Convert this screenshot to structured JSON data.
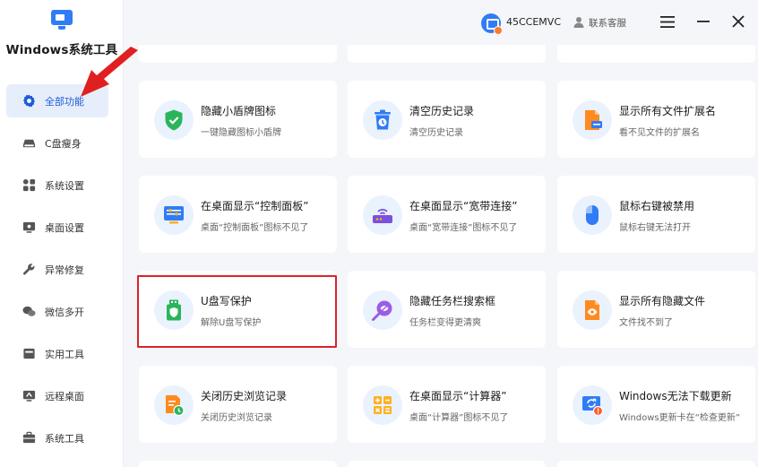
{
  "app": {
    "title": "Windows系统工具"
  },
  "sidebar": {
    "items": [
      {
        "label": "全部功能",
        "icon": "gear-icon",
        "active": true
      },
      {
        "label": "C盘瘦身",
        "icon": "drive-icon"
      },
      {
        "label": "系统设置",
        "icon": "grid-icon"
      },
      {
        "label": "桌面设置",
        "icon": "monitor-icon"
      },
      {
        "label": "异常修复",
        "icon": "wrench-icon"
      },
      {
        "label": "微信多开",
        "icon": "chat-icon"
      },
      {
        "label": "实用工具",
        "icon": "toolbox-icon"
      },
      {
        "label": "远程桌面",
        "icon": "remote-icon"
      },
      {
        "label": "系统工具",
        "icon": "briefcase-icon"
      }
    ]
  },
  "topbar": {
    "user_name": "45CCEMVC",
    "service_label": "联系客服",
    "menu_icon": "hamburger-icon",
    "minimize_icon": "minimize-icon",
    "close_icon": "close-icon"
  },
  "cards": [
    {
      "title": "隐藏小盾牌图标",
      "desc": "一键隐藏图标小盾牌",
      "icon": "shield-check-icon"
    },
    {
      "title": "清空历史记录",
      "desc": "清空历史记录",
      "icon": "trash-clock-icon"
    },
    {
      "title": "显示所有文件扩展名",
      "desc": "看不见文件的扩展名",
      "icon": "file-extension-icon"
    },
    {
      "title": "在桌面显示“控制面板”",
      "desc": "桌面“控制面板”图标不见了",
      "icon": "control-panel-icon"
    },
    {
      "title": "在桌面显示“宽带连接”",
      "desc": "桌面“宽带连接”图标不见了",
      "icon": "router-icon"
    },
    {
      "title": "鼠标右键被禁用",
      "desc": "鼠标右键无法打开",
      "icon": "mouse-icon"
    },
    {
      "title": "U盘写保护",
      "desc": "解除U盘写保护",
      "icon": "usb-shield-icon"
    },
    {
      "title": "隐藏任务栏搜索框",
      "desc": "任务栏变得更清爽",
      "icon": "hidden-search-icon"
    },
    {
      "title": "显示所有隐藏文件",
      "desc": "文件找不到了",
      "icon": "eye-file-icon"
    },
    {
      "title": "关闭历史浏览记录",
      "desc": "关闭历史浏览记录",
      "icon": "history-file-icon"
    },
    {
      "title": "在桌面显示“计算器”",
      "desc": "桌面“计算器”图标不见了",
      "icon": "calculator-icon"
    },
    {
      "title": "Windows无法下载更新",
      "desc": "Windows更新卡在“检查更新”",
      "icon": "update-icon"
    }
  ],
  "colors": {
    "accent": "#1e5bd8",
    "highlight_border": "#d9242b",
    "arrow": "#e02020",
    "active_bg": "#e6eefb"
  }
}
